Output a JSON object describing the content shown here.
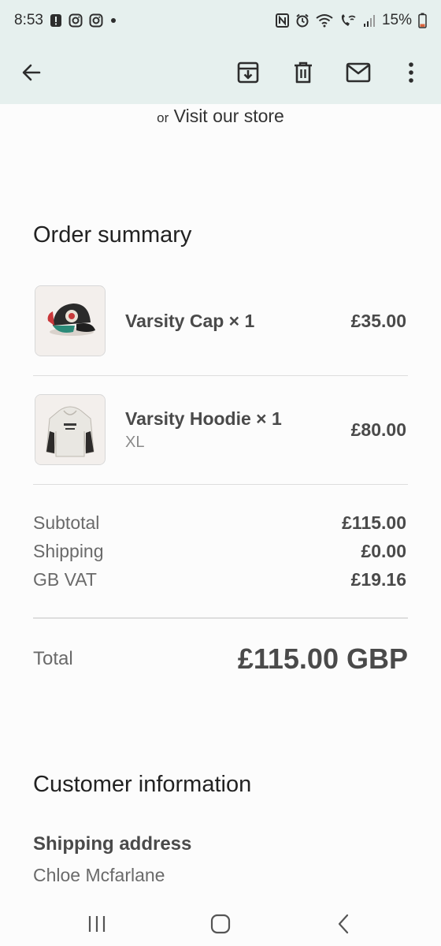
{
  "status_bar": {
    "time": "8:53",
    "battery": "15%",
    "left_icons": [
      "alert-icon",
      "instagram-icon",
      "instagram-icon",
      "dot-icon"
    ],
    "right_icons": [
      "nfc-icon",
      "alarm-icon",
      "wifi-icon",
      "wifi-calling-icon",
      "signal-icon",
      "battery-icon"
    ]
  },
  "app_bar": {
    "icons": [
      "back-arrow-icon",
      "archive-icon",
      "delete-icon",
      "mail-icon",
      "more-vert-icon"
    ]
  },
  "visit": {
    "or": "or",
    "link": "Visit our store"
  },
  "order_summary": {
    "title": "Order summary",
    "items": [
      {
        "name": "Varsity Cap × 1",
        "variant": "",
        "price": "£35.00",
        "image": "cap-image"
      },
      {
        "name": "Varsity Hoodie × 1",
        "variant": "XL",
        "price": "£80.00",
        "image": "hoodie-image"
      }
    ],
    "rows": [
      {
        "label": "Subtotal",
        "value": "£115.00"
      },
      {
        "label": "Shipping",
        "value": "£0.00"
      },
      {
        "label": "GB VAT",
        "value": "£19.16"
      }
    ],
    "total_label": "Total",
    "total_value": "£115.00 GBP"
  },
  "customer_info": {
    "title": "Customer information",
    "shipping_heading": "Shipping address",
    "name": "Chloe Mcfarlane"
  },
  "nav_bar": {
    "icons": [
      "recents-icon",
      "home-icon",
      "back-icon"
    ]
  },
  "colors": {
    "app_bar_bg": "#e6f0ee",
    "text_primary": "#222222",
    "text_secondary": "#6a6a6a"
  }
}
